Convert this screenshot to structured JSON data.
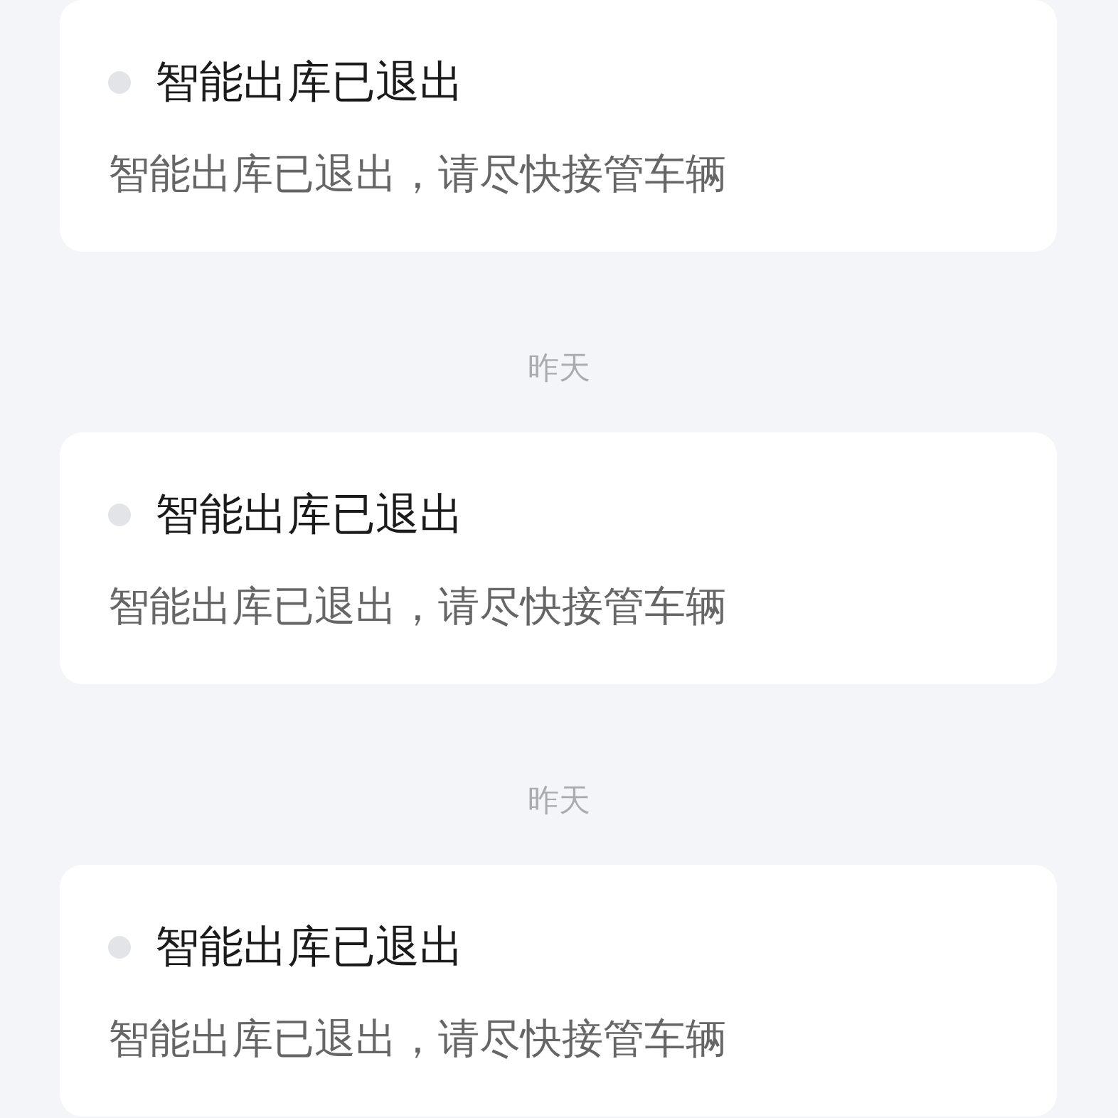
{
  "messages": [
    {
      "title": "智能出库已退出",
      "body": "智能出库已退出，请尽快接管车辆",
      "unread": false
    },
    {
      "date": "昨天",
      "title": "智能出库已退出",
      "body": "智能出库已退出，请尽快接管车辆",
      "unread": false
    },
    {
      "date": "昨天",
      "title": "智能出库已退出",
      "body": "智能出库已退出，请尽快接管车辆",
      "unread": false
    }
  ]
}
